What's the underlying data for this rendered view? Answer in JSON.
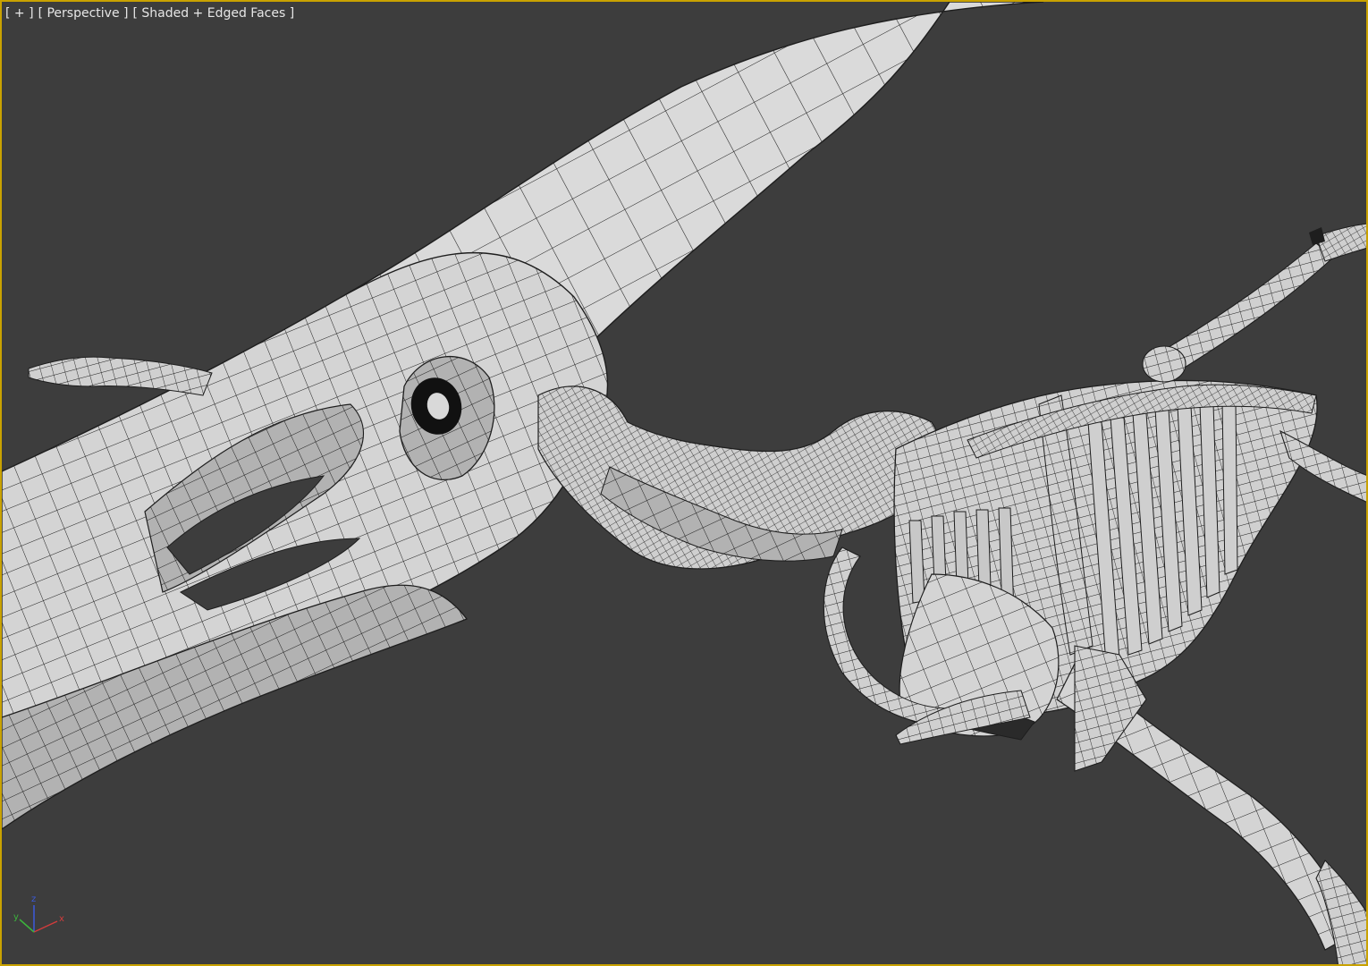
{
  "viewport": {
    "menus": {
      "general": "[ + ]",
      "view": "[ Perspective ]",
      "shading": "[ Shaded + Edged Faces ]"
    }
  },
  "gizmo": {
    "x_label": "x",
    "y_label": "y",
    "z_label": "z",
    "x_color": "#d23c3c",
    "y_color": "#3cb43c",
    "z_color": "#3c5adc"
  },
  "scene": {
    "background": "#3d3d3d",
    "mesh_fill": "#d9d9d9",
    "mesh_shadow": "#a8a8a8",
    "edge_color": "#1e1e1e",
    "border_color": "#c9a200"
  }
}
